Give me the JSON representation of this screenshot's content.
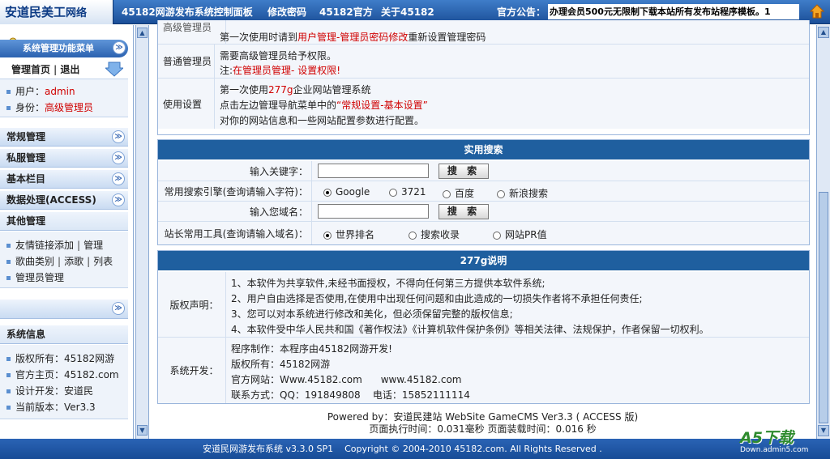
{
  "header": {
    "logo": "安道民美工",
    "logo_suffix": "网络",
    "nav": [
      "45182网游发布系统控制面板",
      "修改密码",
      "45182官方",
      "关于45182"
    ],
    "notice_label": "官方公告：",
    "notice_text": "办理会员500元无限制下载本站所有发布站程序模板。1"
  },
  "sidebar": {
    "menu_title": "系统管理功能菜单",
    "home_link": "管理首页",
    "logout_link": "退出",
    "user_label": "用户：",
    "user_value": "admin",
    "role_label": "身份：",
    "role_value": "高级管理员",
    "categories": [
      "常规管理",
      "私服管理",
      "基本栏目",
      "数据处理(ACCESS)"
    ],
    "other_title": "其他管理",
    "other_items": [
      {
        "a": "友情链接添加",
        "b": "管理"
      },
      {
        "a": "歌曲类别",
        "b": "添歌",
        "c": "列表"
      },
      {
        "a": "管理员管理"
      }
    ],
    "sysinfo_title": "系统信息",
    "sysinfo": [
      "版权所有：45182网游",
      "官方主页：45182.com",
      "设计开发：安道民",
      "当前版本：Ver3.3"
    ]
  },
  "help_panel": {
    "row0_label": "高级管理员",
    "row0_pre": "第一次使用时请到",
    "row0_link": "用户管理-管理员密码修改",
    "row0_post": "重新设置管理密码",
    "row1_label": "普通管理员",
    "row1_line1": "需要高级管理员给予权限。",
    "row1_note": "注:",
    "row1_link": "在管理员管理- 设置权限!",
    "row2_label": "使用设置",
    "row2_pre": "第一次使用",
    "row2_brand": "277g",
    "row2_post": "企业网站管理系统",
    "row2_line2_pre": "点击左边管理导航菜单中的",
    "row2_line2_link": "“常规设置-基本设置”",
    "row2_line3": "对你的网站信息和一些网站配置参数进行配置。"
  },
  "search_panel": {
    "title": "实用搜索",
    "keyword_label": "输入关键字：",
    "search_button": "搜 索",
    "engine_label": "常用搜索引擎(查询请输入字符)：",
    "engines": [
      "Google",
      "3721",
      "百度",
      "新浪搜索"
    ],
    "domain_label": "输入您域名：",
    "domain_button": "搜 索",
    "tools_label": "站长常用工具(查询请输入域名)：",
    "tools": [
      "世界排名",
      "搜索收录",
      "网站PR值"
    ]
  },
  "about_panel": {
    "title": "277g说明",
    "copyright_label": "版权声明：",
    "copyright_lines": [
      "1、本软件为共享软件,未经书面授权，不得向任何第三方提供本软件系统;",
      "2、用户自由选择是否使用,在使用中出现任何问题和由此造成的一切损失作者将不承担任何责任;",
      "3、您可以对本系统进行修改和美化，但必须保留完整的版权信息;",
      "4、本软件受中华人民共和国《著作权法》《计算机软件保护条例》等相关法律、法规保护，作者保留一切权利。"
    ],
    "dev_label": "系统开发：",
    "dev_lines": [
      "程序制作：本程序由45182网游开发!",
      "版权所有：45182网游",
      "官方网站：Www.45182.com      www.45182.com",
      "联系方式：QQ：191849808    电话：15852111114"
    ]
  },
  "footer": {
    "line1": "Powered by：安道民建站  WebSite GameCMS Ver3.3 ( ACCESS 版)",
    "line2": "页面执行时间：0.031毫秒   页面装载时间：0.016 秒"
  },
  "bottom": {
    "text": "安道民网游发布系统 v3.3.0 SP1    Copyright © 2004-2010 45182.com. All Rights Reserved .",
    "watermark_top": "A5下载",
    "watermark_bottom": "Down.admin5.com"
  }
}
